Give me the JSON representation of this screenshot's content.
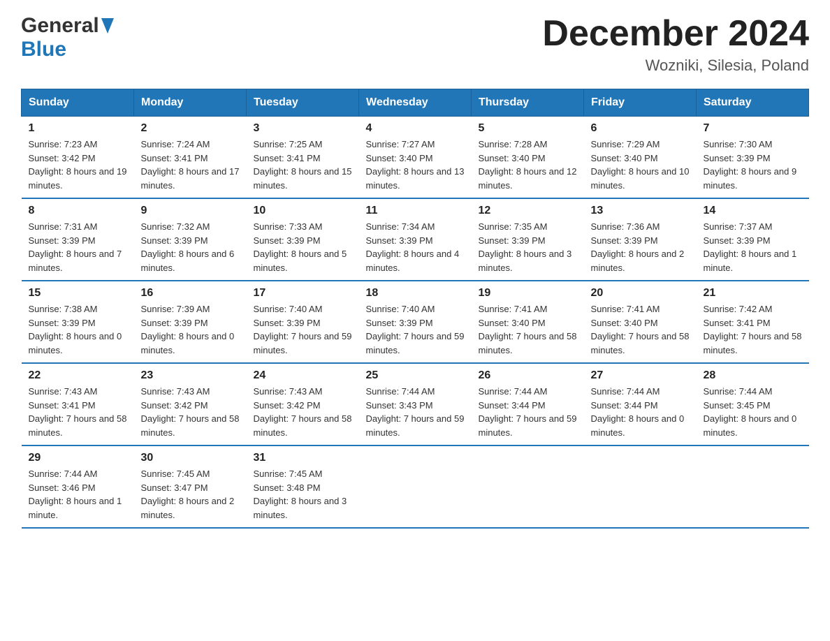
{
  "header": {
    "logo_general": "General",
    "logo_blue": "Blue",
    "month_title": "December 2024",
    "location": "Wozniki, Silesia, Poland"
  },
  "days_of_week": [
    "Sunday",
    "Monday",
    "Tuesday",
    "Wednesday",
    "Thursday",
    "Friday",
    "Saturday"
  ],
  "weeks": [
    [
      {
        "day": "1",
        "sunrise": "7:23 AM",
        "sunset": "3:42 PM",
        "daylight": "8 hours and 19 minutes."
      },
      {
        "day": "2",
        "sunrise": "7:24 AM",
        "sunset": "3:41 PM",
        "daylight": "8 hours and 17 minutes."
      },
      {
        "day": "3",
        "sunrise": "7:25 AM",
        "sunset": "3:41 PM",
        "daylight": "8 hours and 15 minutes."
      },
      {
        "day": "4",
        "sunrise": "7:27 AM",
        "sunset": "3:40 PM",
        "daylight": "8 hours and 13 minutes."
      },
      {
        "day": "5",
        "sunrise": "7:28 AM",
        "sunset": "3:40 PM",
        "daylight": "8 hours and 12 minutes."
      },
      {
        "day": "6",
        "sunrise": "7:29 AM",
        "sunset": "3:40 PM",
        "daylight": "8 hours and 10 minutes."
      },
      {
        "day": "7",
        "sunrise": "7:30 AM",
        "sunset": "3:39 PM",
        "daylight": "8 hours and 9 minutes."
      }
    ],
    [
      {
        "day": "8",
        "sunrise": "7:31 AM",
        "sunset": "3:39 PM",
        "daylight": "8 hours and 7 minutes."
      },
      {
        "day": "9",
        "sunrise": "7:32 AM",
        "sunset": "3:39 PM",
        "daylight": "8 hours and 6 minutes."
      },
      {
        "day": "10",
        "sunrise": "7:33 AM",
        "sunset": "3:39 PM",
        "daylight": "8 hours and 5 minutes."
      },
      {
        "day": "11",
        "sunrise": "7:34 AM",
        "sunset": "3:39 PM",
        "daylight": "8 hours and 4 minutes."
      },
      {
        "day": "12",
        "sunrise": "7:35 AM",
        "sunset": "3:39 PM",
        "daylight": "8 hours and 3 minutes."
      },
      {
        "day": "13",
        "sunrise": "7:36 AM",
        "sunset": "3:39 PM",
        "daylight": "8 hours and 2 minutes."
      },
      {
        "day": "14",
        "sunrise": "7:37 AM",
        "sunset": "3:39 PM",
        "daylight": "8 hours and 1 minute."
      }
    ],
    [
      {
        "day": "15",
        "sunrise": "7:38 AM",
        "sunset": "3:39 PM",
        "daylight": "8 hours and 0 minutes."
      },
      {
        "day": "16",
        "sunrise": "7:39 AM",
        "sunset": "3:39 PM",
        "daylight": "8 hours and 0 minutes."
      },
      {
        "day": "17",
        "sunrise": "7:40 AM",
        "sunset": "3:39 PM",
        "daylight": "7 hours and 59 minutes."
      },
      {
        "day": "18",
        "sunrise": "7:40 AM",
        "sunset": "3:39 PM",
        "daylight": "7 hours and 59 minutes."
      },
      {
        "day": "19",
        "sunrise": "7:41 AM",
        "sunset": "3:40 PM",
        "daylight": "7 hours and 58 minutes."
      },
      {
        "day": "20",
        "sunrise": "7:41 AM",
        "sunset": "3:40 PM",
        "daylight": "7 hours and 58 minutes."
      },
      {
        "day": "21",
        "sunrise": "7:42 AM",
        "sunset": "3:41 PM",
        "daylight": "7 hours and 58 minutes."
      }
    ],
    [
      {
        "day": "22",
        "sunrise": "7:43 AM",
        "sunset": "3:41 PM",
        "daylight": "7 hours and 58 minutes."
      },
      {
        "day": "23",
        "sunrise": "7:43 AM",
        "sunset": "3:42 PM",
        "daylight": "7 hours and 58 minutes."
      },
      {
        "day": "24",
        "sunrise": "7:43 AM",
        "sunset": "3:42 PM",
        "daylight": "7 hours and 58 minutes."
      },
      {
        "day": "25",
        "sunrise": "7:44 AM",
        "sunset": "3:43 PM",
        "daylight": "7 hours and 59 minutes."
      },
      {
        "day": "26",
        "sunrise": "7:44 AM",
        "sunset": "3:44 PM",
        "daylight": "7 hours and 59 minutes."
      },
      {
        "day": "27",
        "sunrise": "7:44 AM",
        "sunset": "3:44 PM",
        "daylight": "8 hours and 0 minutes."
      },
      {
        "day": "28",
        "sunrise": "7:44 AM",
        "sunset": "3:45 PM",
        "daylight": "8 hours and 0 minutes."
      }
    ],
    [
      {
        "day": "29",
        "sunrise": "7:44 AM",
        "sunset": "3:46 PM",
        "daylight": "8 hours and 1 minute."
      },
      {
        "day": "30",
        "sunrise": "7:45 AM",
        "sunset": "3:47 PM",
        "daylight": "8 hours and 2 minutes."
      },
      {
        "day": "31",
        "sunrise": "7:45 AM",
        "sunset": "3:48 PM",
        "daylight": "8 hours and 3 minutes."
      },
      null,
      null,
      null,
      null
    ]
  ],
  "labels": {
    "sunrise": "Sunrise:",
    "sunset": "Sunset:",
    "daylight": "Daylight:"
  }
}
